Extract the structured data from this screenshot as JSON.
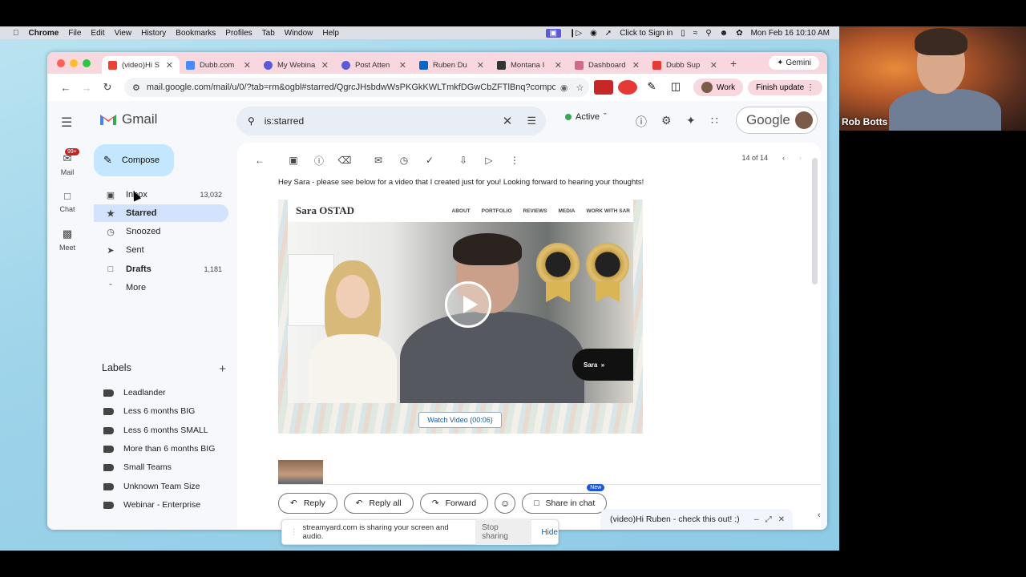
{
  "menubar": {
    "app": "Chrome",
    "items": [
      "File",
      "Edit",
      "View",
      "History",
      "Bookmarks",
      "Profiles",
      "Tab",
      "Window",
      "Help"
    ],
    "signin": "Click to Sign in",
    "datetime": "Mon Feb 16  10:10 AM"
  },
  "webcam": {
    "name": "Rob Botts"
  },
  "tabs": [
    {
      "label": "(video)Hi S",
      "color": "#ea4335",
      "active": true
    },
    {
      "label": "Dubb.com",
      "color": "#4a8af4"
    },
    {
      "label": "My Webina",
      "color": "#5b5bd6"
    },
    {
      "label": "Post Atten",
      "color": "#5b5bd6"
    },
    {
      "label": "Ruben Du",
      "color": "#0a66c2"
    },
    {
      "label": "Montana I",
      "color": "#333333"
    },
    {
      "label": "Dashboard",
      "color": "#d06a8a"
    },
    {
      "label": "Dubb Sup",
      "color": "#e53935"
    }
  ],
  "gemini": "Gemini",
  "omnibox": {
    "url": "mail.google.com/mail/u/0/?tab=rm&ogbl#starred/QgrcJHsbdwWsPKGkKWLTmkfDGwCbZFTlBnq?compo..."
  },
  "profile": {
    "work": "Work",
    "update": "Finish update"
  },
  "gmail": {
    "logo": "Gmail",
    "search_query": "is:starred",
    "status": "Active",
    "google": "Google",
    "rail": [
      {
        "label": "Mail",
        "badge": "99+"
      },
      {
        "label": "Chat"
      },
      {
        "label": "Meet"
      }
    ],
    "compose": "Compose",
    "nav": [
      {
        "label": "Inbox",
        "count": "13,032"
      },
      {
        "label": "Starred",
        "count": ""
      },
      {
        "label": "Snoozed",
        "count": ""
      },
      {
        "label": "Sent",
        "count": ""
      },
      {
        "label": "Drafts",
        "count": "1,181"
      },
      {
        "label": "More",
        "count": ""
      }
    ],
    "labels_title": "Labels",
    "labels": [
      "Leadlander",
      "Less 6 months BIG",
      "Less 6 months SMALL",
      "More than 6 months BIG",
      "Small Teams",
      "Unknown Team Size",
      "Webinar - Enterprise"
    ],
    "pager": "14 of 14",
    "body_text": "Hey Sara - please see below for a video that I created just for you! Looking forward to hearing your thoughts!",
    "video": {
      "brand": "Sara OSTAD",
      "nav": [
        "ABOUT",
        "PORTFOLIO",
        "REVIEWS",
        "MEDIA",
        "WORK WITH SAR"
      ],
      "cta": "Sara",
      "watch": "Watch Video (00:06)"
    },
    "reply": "Reply",
    "reply_all": "Reply all",
    "forward": "Forward",
    "share_chat": "Share in chat",
    "new_badge": "New",
    "mini_compose": "(video)Hi Ruben - check this out! :)"
  },
  "share_banner": {
    "text": "streamyard.com is sharing your screen and audio.",
    "stop": "Stop sharing",
    "hide": "Hide"
  }
}
